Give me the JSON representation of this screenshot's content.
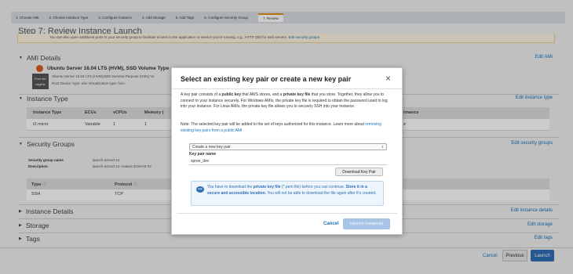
{
  "wizard": {
    "steps": [
      "1. Choose AMI",
      "2. Choose Instance Type",
      "3. Configure Instance",
      "4. Add Storage",
      "5. Add Tags",
      "6. Configure Security Group",
      "7. Review"
    ]
  },
  "page": {
    "title": "Step 7: Review Instance Launch",
    "banner": "You can also open additional ports in your security group to facilitate access to the application or service you're running, e.g., HTTP (80) for web servers.",
    "banner_link": "Edit security groups"
  },
  "ami": {
    "heading": "AMI Details",
    "edit": "Edit AMI",
    "name": "Ubuntu Server 16.04 LTS (HVM), SSD Volume Type -",
    "id_fragment": "ami-6d7e9",
    "desc": "Ubuntu Server 16.04 LTS (HVM),EBS General Purpose (SSD) Vo",
    "badge_line1": "Free tier",
    "badge_line2": "eligible",
    "meta": "Root Device Type: ebs    Virtualization type: hvm"
  },
  "instance": {
    "heading": "Instance Type",
    "edit": "Edit instance type",
    "columns": [
      "Instance Type",
      "ECUs",
      "vCPUs",
      "Memory (",
      "rmance"
    ],
    "row": [
      "t2.micro",
      "Variable",
      "1",
      "1",
      "e"
    ]
  },
  "sg": {
    "heading": "Security Groups",
    "edit": "Edit security groups",
    "name_label": "Security group name",
    "name_value": "launch-wizard-13",
    "desc_label": "Description",
    "desc_value": "launch-wizard-13 created 2018-05-02",
    "columns": [
      "Type",
      "Protocol"
    ],
    "row": [
      "SSH",
      "TCP"
    ]
  },
  "collapsed": {
    "details": "Instance Details",
    "details_edit": "Edit instance details",
    "storage": "Storage",
    "storage_edit": "Edit storage",
    "tags": "Tags",
    "tags_edit": "Edit tags"
  },
  "footer": {
    "cancel": "Cancel",
    "previous": "Previous",
    "launch": "Launch"
  },
  "modal": {
    "title": "Select an existing key pair or create a new key pair",
    "close": "×",
    "p1_a": "A key pair consists of a ",
    "p1_b": "public key",
    "p1_c": " that AWS stores, and a ",
    "p1_d": "private key file",
    "p1_e": " that you store. Together, they allow you to connect to your instance securely. For Windows AMIs, the private key file is required to obtain the password used to log into your instance. For Linux AMIs, the private key file allows you to securely SSH into your instance.",
    "p2_a": "Note: The selected key pair will be added to the set of keys authorized for this instance. Learn more about ",
    "p2_link": "removing existing key pairs from a public AMI",
    ".": ".",
    "select_value": "Create a new key pair",
    "kp_label": "Key pair name",
    "kp_value": "spree_dev",
    "download": "Download Key Pair",
    "info_a": "You have to download the ",
    "info_b": "private key file",
    "info_c": " (*.pem file) before you can continue. ",
    "info_d": "Store it in a secure and accessible location.",
    "info_e": " You will not be able to download the file again after it's created.",
    "cancel": "Cancel",
    "launch": "Launch Instances"
  },
  "colors": {
    "accent": "#1a73b8",
    "launch": "#2f6fb5",
    "wizard_active": "#e88b1a"
  }
}
